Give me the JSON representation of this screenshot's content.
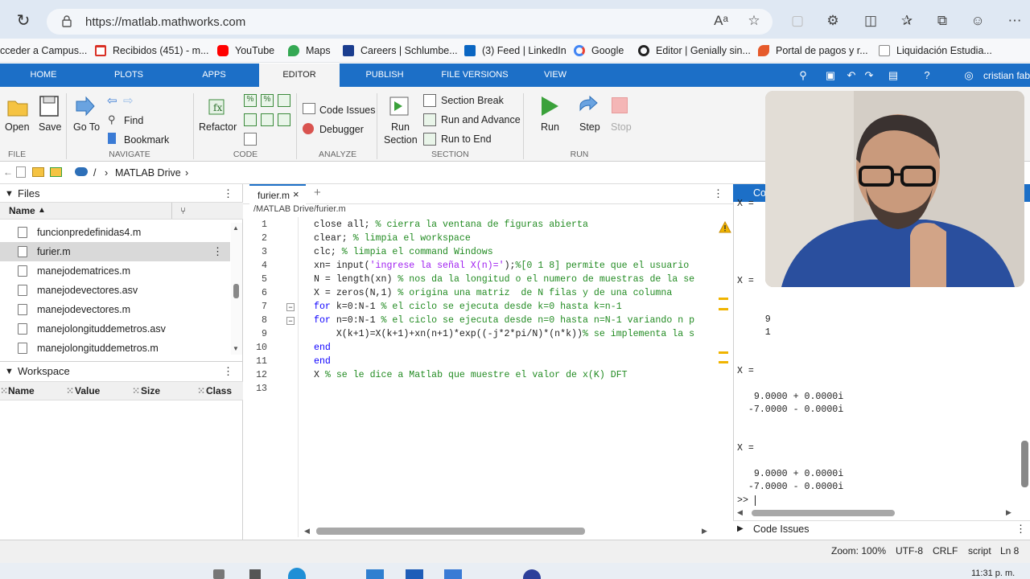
{
  "browser": {
    "url": "https://matlab.mathworks.com",
    "icons": [
      "reload-icon",
      "lock-icon",
      "read-aloud-icon",
      "favorite-star-icon",
      "extensions-icon",
      "split-screen-icon",
      "favorites-icon",
      "collections-icon",
      "profile-icon"
    ]
  },
  "bookmarks": [
    {
      "label": "cceder a Campus...",
      "icon": "campus-icon"
    },
    {
      "label": "Recibidos (451) - m...",
      "icon": "gmail-icon"
    },
    {
      "label": "YouTube",
      "icon": "youtube-icon"
    },
    {
      "label": "Maps",
      "icon": "maps-icon"
    },
    {
      "label": "Careers | Schlumbe...",
      "icon": "careers-icon"
    },
    {
      "label": "(3) Feed | LinkedIn",
      "icon": "linkedin-icon"
    },
    {
      "label": "Google",
      "icon": "google-icon"
    },
    {
      "label": "Editor | Genially sin...",
      "icon": "genially-icon"
    },
    {
      "label": "Portal de pagos y r...",
      "icon": "portal-icon"
    },
    {
      "label": "Liquidación Estudia...",
      "icon": "liquidacion-icon"
    }
  ],
  "matlab_tabs": [
    "HOME",
    "PLOTS",
    "APPS",
    "EDITOR",
    "PUBLISH",
    "FILE VERSIONS",
    "VIEW"
  ],
  "user_name": "cristian fab",
  "toolstrip": {
    "file": {
      "open": "Open",
      "save": "Save",
      "group": "FILE"
    },
    "navigate": {
      "goto": "Go To",
      "find": "Find",
      "bookmark": "Bookmark",
      "group": "NAVIGATE"
    },
    "code": {
      "refactor": "Refactor",
      "group": "CODE"
    },
    "analyze": {
      "code_issues": "Code Issues",
      "debugger": "Debugger",
      "group": "ANALYZE"
    },
    "section": {
      "run_section_1": "Run",
      "run_section_2": "Section",
      "section_break": "Section Break",
      "run_and_advance": "Run and Advance",
      "run_to_end": "Run to End",
      "group": "SECTION"
    },
    "run": {
      "run": "Run",
      "step": "Step",
      "stop": "Stop",
      "group": "RUN"
    }
  },
  "address": {
    "root": "/",
    "folder": "MATLAB Drive"
  },
  "files": {
    "title": "Files",
    "col_name": "Name",
    "items": [
      {
        "name": "funcionpredefinidas4.m",
        "kind": "m"
      },
      {
        "name": "furier.m",
        "kind": "m"
      },
      {
        "name": "manejodematrices.m",
        "kind": "m"
      },
      {
        "name": "manejodevectores.asv",
        "kind": "asv"
      },
      {
        "name": "manejodevectores.m",
        "kind": "m"
      },
      {
        "name": "manejolongituddemetros.asv",
        "kind": "asv"
      },
      {
        "name": "manejolongituddemetros.m",
        "kind": "m"
      }
    ],
    "selected_index": 1
  },
  "workspace": {
    "title": "Workspace",
    "cols": [
      "Name",
      "Value",
      "Size",
      "Class"
    ]
  },
  "editor": {
    "tab": "furier.m",
    "path": "/MATLAB Drive/furier.m",
    "lines": [
      "close all; % cierra la ventana de figuras abierta",
      "clear; % limpia el workspace",
      "clc; % limpia el command Windows",
      "xn= input('ingrese la señal X(n)=');%[0 1 8] permite que el usuario",
      "N = length(xn) % nos da la longitud o el numero de muestras de la se",
      "X = zeros(N,1) % origina una matriz  de N filas y de una columna",
      "for k=0:N-1 % el ciclo se ejecuta desde k=0 hasta k=n-1",
      "for n=0:N-1 % el ciclo se ejecuta desde n=0 hasta n=N-1 variando n p",
      "    X(k+1)=X(k+1)+xn(n+1)*exp((-j*2*pi/N)*(n*k))% se implementa la s",
      "end",
      "end",
      "X % se le dice a Matlab que muestre el valor de x(K) DFT",
      ""
    ],
    "line_numbers": [
      "1",
      "2",
      "3",
      "4",
      "5",
      "6",
      "7",
      "8",
      "9",
      "10",
      "11",
      "12",
      "13"
    ]
  },
  "command_window": {
    "title": "Co",
    "lines_a": [
      "X ="
    ],
    "lines_b": [
      "X =",
      "",
      "",
      "     9",
      "     1",
      "",
      "",
      "X =",
      "",
      "   9.0000 + 0.0000i",
      "  -7.0000 - 0.0000i",
      "",
      "",
      "X =",
      "",
      "   9.0000 + 0.0000i",
      "  -7.0000 - 0.0000i"
    ],
    "prompt": ">>",
    "code_issues": "Code Issues"
  },
  "status": {
    "zoom": "Zoom: 100%",
    "encoding": "UTF-8",
    "eol": "CRLF",
    "mode": "script",
    "line": "Ln 8"
  },
  "taskbar": {
    "clock": "11:31 p. m."
  },
  "colors": {
    "accent": "#1c6fc7",
    "keyword": "#0e00ff",
    "comment": "#228b22",
    "string": "#a020f0",
    "warning": "#e8a000"
  }
}
